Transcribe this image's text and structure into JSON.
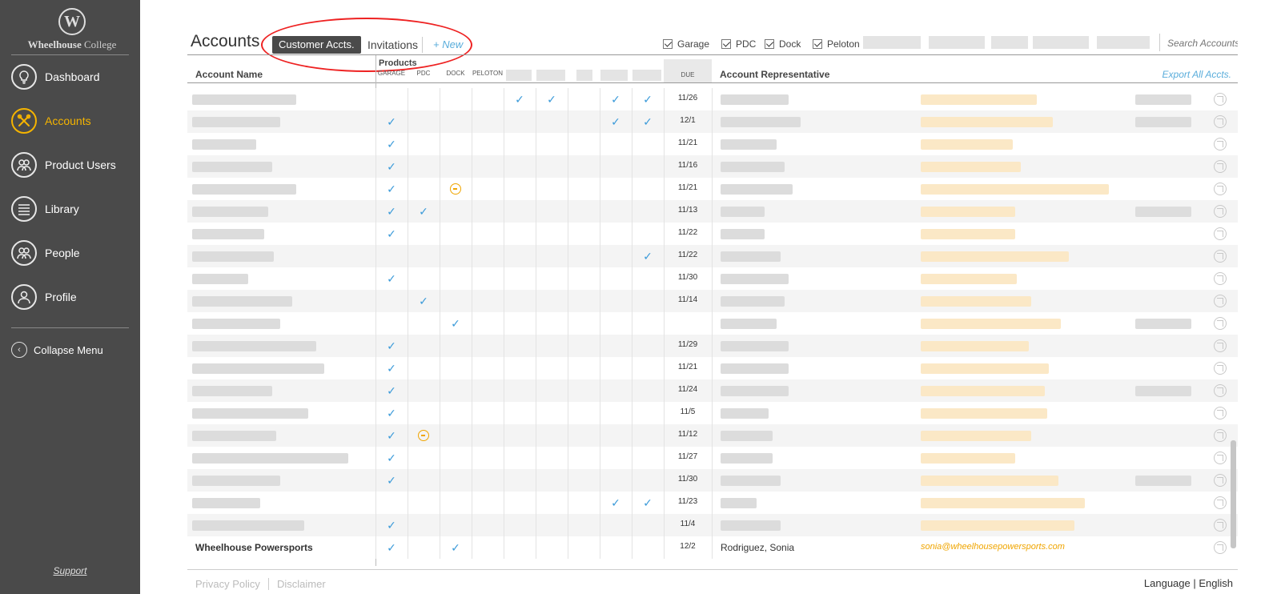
{
  "app": {
    "logo_mark": "W",
    "logo_bold": "Wheelhouse",
    "logo_light": "College",
    "support": "Support"
  },
  "nav": {
    "items": [
      {
        "label": "Dashboard",
        "icon": "lightbulb-icon",
        "active": false
      },
      {
        "label": "Accounts",
        "icon": "tools-icon",
        "active": true
      },
      {
        "label": "Product Users",
        "icon": "users-icon",
        "active": false
      },
      {
        "label": "Library",
        "icon": "books-icon",
        "active": false
      },
      {
        "label": "People",
        "icon": "people-icon",
        "active": false
      },
      {
        "label": "Profile",
        "icon": "profile-icon",
        "active": false
      }
    ],
    "collapse_label": "Collapse Menu"
  },
  "header": {
    "title": "Accounts",
    "tab_active": "Customer Accts.",
    "tab_invitations": "Invitations",
    "new_label": "+ New",
    "filters": [
      "Garage",
      "PDC",
      "Dock",
      "Peloton"
    ],
    "search_placeholder": "Search Accounts"
  },
  "table": {
    "products_label": "Products",
    "product_columns": [
      "GARAGE",
      "PDC",
      "DOCK",
      "PELOTON"
    ],
    "due_label": "DUE",
    "name_header": "Account Name",
    "rep_header": "Account Representative",
    "export_label": "Export All Accts.",
    "rows": [
      {
        "due": "11/26",
        "checks": [
          false,
          false,
          false,
          false,
          true,
          true,
          false,
          true,
          true
        ],
        "minus": null
      },
      {
        "due": "12/1",
        "checks": [
          true,
          false,
          false,
          false,
          false,
          false,
          false,
          true,
          true
        ],
        "minus": null
      },
      {
        "due": "11/21",
        "checks": [
          true,
          false,
          false,
          false,
          false,
          false,
          false,
          false,
          false
        ],
        "minus": null
      },
      {
        "due": "11/16",
        "checks": [
          true,
          false,
          false,
          false,
          false,
          false,
          false,
          false,
          false
        ],
        "minus": null
      },
      {
        "due": "11/21",
        "checks": [
          true,
          false,
          false,
          false,
          false,
          false,
          false,
          false,
          false
        ],
        "minus": 2
      },
      {
        "due": "11/13",
        "checks": [
          true,
          true,
          false,
          false,
          false,
          false,
          false,
          false,
          false
        ],
        "minus": null
      },
      {
        "due": "11/22",
        "checks": [
          true,
          false,
          false,
          false,
          false,
          false,
          false,
          false,
          false
        ],
        "minus": null
      },
      {
        "due": "11/22",
        "checks": [
          false,
          false,
          false,
          false,
          false,
          false,
          false,
          false,
          true
        ],
        "minus": null
      },
      {
        "due": "11/30",
        "checks": [
          true,
          false,
          false,
          false,
          false,
          false,
          false,
          false,
          false
        ],
        "minus": null
      },
      {
        "due": "11/14",
        "checks": [
          false,
          true,
          false,
          false,
          false,
          false,
          false,
          false,
          false
        ],
        "minus": null
      },
      {
        "due": "",
        "checks": [
          false,
          false,
          true,
          false,
          false,
          false,
          false,
          false,
          false
        ],
        "minus": null
      },
      {
        "due": "11/29",
        "checks": [
          true,
          false,
          false,
          false,
          false,
          false,
          false,
          false,
          false
        ],
        "minus": null
      },
      {
        "due": "11/21",
        "checks": [
          true,
          false,
          false,
          false,
          false,
          false,
          false,
          false,
          false
        ],
        "minus": null
      },
      {
        "due": "11/24",
        "checks": [
          true,
          false,
          false,
          false,
          false,
          false,
          false,
          false,
          false
        ],
        "minus": null
      },
      {
        "due": "11/5",
        "checks": [
          true,
          false,
          false,
          false,
          false,
          false,
          false,
          false,
          false
        ],
        "minus": null
      },
      {
        "due": "11/12",
        "checks": [
          true,
          false,
          false,
          false,
          false,
          false,
          false,
          false,
          false
        ],
        "minus": 1
      },
      {
        "due": "11/27",
        "checks": [
          true,
          false,
          false,
          false,
          false,
          false,
          false,
          false,
          false
        ],
        "minus": null
      },
      {
        "due": "11/30",
        "checks": [
          true,
          false,
          false,
          false,
          false,
          false,
          false,
          false,
          false
        ],
        "minus": null
      },
      {
        "due": "11/23",
        "checks": [
          false,
          false,
          false,
          false,
          false,
          false,
          false,
          true,
          true
        ],
        "minus": null
      },
      {
        "due": "11/4",
        "checks": [
          true,
          false,
          false,
          false,
          false,
          false,
          false,
          false,
          false
        ],
        "minus": null
      }
    ],
    "last_row": {
      "name": "Wheelhouse Powersports",
      "due": "12/2",
      "rep": "Rodriguez, Sonia",
      "email": "sonia@wheelhousepowersports.com",
      "checks": [
        true,
        false,
        true,
        false,
        false,
        false,
        false,
        false,
        false
      ]
    }
  },
  "footer": {
    "privacy": "Privacy Policy",
    "disclaimer": "Disclaimer",
    "language_label": "Language",
    "language_value": "English"
  },
  "colors": {
    "sidebar": "#4a4a4a",
    "accent": "#f5b400",
    "link": "#5aaddb",
    "check": "#3a9ad9",
    "annotation": "#ee2222"
  }
}
